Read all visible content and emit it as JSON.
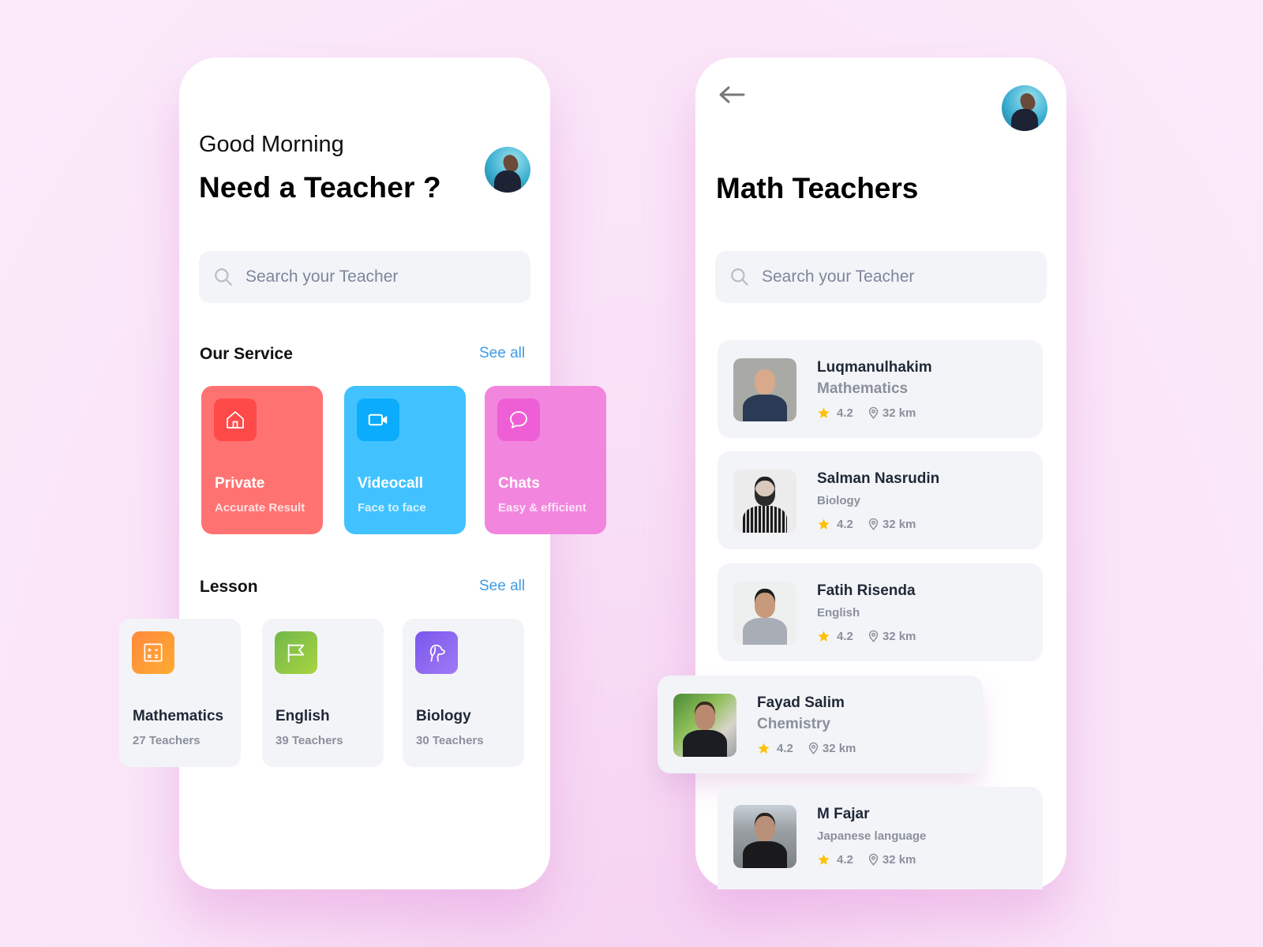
{
  "left_screen": {
    "greeting": "Good Morning",
    "headline": "Need a Teacher ?",
    "search": {
      "placeholder": "Search your Teacher",
      "value": ""
    },
    "services_section": {
      "title": "Our Service",
      "see_all": "See all",
      "items": [
        {
          "title": "Private",
          "subtitle": "Accurate Result",
          "icon": "home-icon",
          "color": "#ff7272",
          "icon_bg": "#ff4a4a"
        },
        {
          "title": "Videocall",
          "subtitle": "Face to face",
          "icon": "video-camera-icon",
          "color": "#41c2fe",
          "icon_bg": "#0bacfc"
        },
        {
          "title": "Chats",
          "subtitle": "Easy & efficient",
          "icon": "chat-bubble-icon",
          "color": "#f286de",
          "icon_bg": "#ee5fd6"
        }
      ]
    },
    "lesson_section": {
      "title": "Lesson",
      "see_all": "See all",
      "items": [
        {
          "title": "Mathematics",
          "subtitle": "27 Teachers",
          "icon": "calculator-icon"
        },
        {
          "title": "English",
          "subtitle": "39 Teachers",
          "icon": "flag-icon"
        },
        {
          "title": "Biology",
          "subtitle": "30 Teachers",
          "icon": "dog-icon"
        }
      ]
    }
  },
  "right_screen": {
    "back_icon": "arrow-left-icon",
    "title": "Math Teachers",
    "search": {
      "placeholder": "Search your Teacher",
      "value": ""
    },
    "teachers": [
      {
        "name": "Luqmanulhakim",
        "subject": "Mathematics",
        "rating": "4.2",
        "distance": "32 km"
      },
      {
        "name": "Salman Nasrudin",
        "subject": "Biology",
        "rating": "4.2",
        "distance": "32 km"
      },
      {
        "name": "Fatih Risenda",
        "subject": "English",
        "rating": "4.2",
        "distance": "32 km"
      },
      {
        "name": "Fayad Salim",
        "subject": "Chemistry",
        "rating": "4.2",
        "distance": "32 km"
      },
      {
        "name": "M Fajar",
        "subject": "Japanese language",
        "rating": "4.2",
        "distance": "32 km"
      }
    ]
  },
  "colors": {
    "accent_link": "#3d9be9",
    "star": "#ffc107",
    "card_bg": "#f3f4f7"
  }
}
